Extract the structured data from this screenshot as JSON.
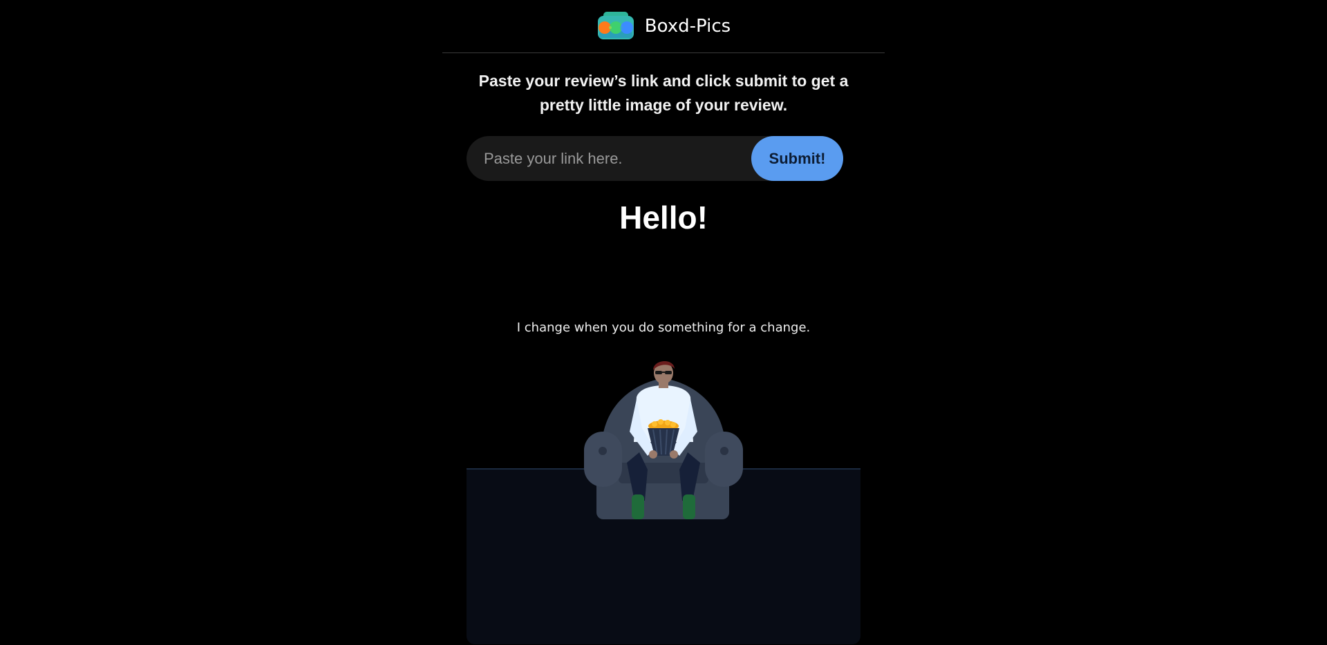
{
  "header": {
    "brand": "Boxd-Pics",
    "logo_icon": "camera-circles-icon"
  },
  "intro": {
    "text": "Paste your review’s link and click submit to get a pretty little image of your review."
  },
  "form": {
    "input_placeholder": "Paste your link here.",
    "input_value": "",
    "submit_label": "Submit!"
  },
  "main": {
    "greeting": "Hello!",
    "subtext": "I change when you do something for a change."
  },
  "illustration": {
    "icon": "person-on-armchair-with-popcorn-icon"
  },
  "colors": {
    "background": "#000000",
    "accent": "#5a9cf0",
    "input_bg": "#1a1a1a",
    "floor": "#080c15",
    "armchair": "#3a4557"
  }
}
